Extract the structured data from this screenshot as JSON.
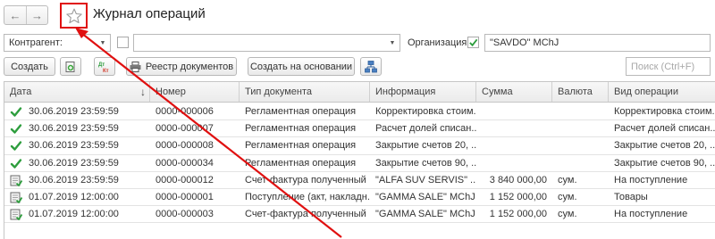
{
  "window": {
    "title": "Журнал операций",
    "back_icon": "arrow-left-icon",
    "forward_icon": "arrow-right-icon",
    "favorite_icon": "star-icon"
  },
  "filters": {
    "counterparty_label": "Контрагент:",
    "counterparty_value": "",
    "counterparty_checked": false,
    "organization_label": "Организация:",
    "organization_checked": true,
    "organization_value": "\"SAVDO\" MChJ"
  },
  "toolbar": {
    "create_label": "Создать",
    "registry_label": "Реестр документов",
    "create_based_label": "Создать на основании",
    "search_placeholder": "Поиск (Ctrl+F)",
    "icons": [
      "add-copy-icon",
      "dt-kt-icon",
      "printer-icon",
      "structure-icon"
    ]
  },
  "table": {
    "columns": [
      "Дата",
      "Номер",
      "Тип документа",
      "Информация",
      "Сумма",
      "Валюта",
      "Вид операции"
    ],
    "sort_column": "Дата",
    "rows": [
      {
        "status": "posted",
        "date": "30.06.2019 23:59:59",
        "number": "0000-000006",
        "type": "Регламентная операция",
        "info": "Корректировка стоим...",
        "sum": "",
        "currency": "",
        "operation": "Корректировка стоим..."
      },
      {
        "status": "posted",
        "date": "30.06.2019 23:59:59",
        "number": "0000-000007",
        "type": "Регламентная операция",
        "info": "Расчет долей списан...",
        "sum": "",
        "currency": "",
        "operation": "Расчет долей списан..."
      },
      {
        "status": "posted",
        "date": "30.06.2019 23:59:59",
        "number": "0000-000008",
        "type": "Регламентная операция",
        "info": "Закрытие счетов 20, ...",
        "sum": "",
        "currency": "",
        "operation": "Закрытие счетов 20, ..."
      },
      {
        "status": "posted",
        "date": "30.06.2019 23:59:59",
        "number": "0000-000034",
        "type": "Регламентная операция",
        "info": "Закрытие счетов 90, ...",
        "sum": "",
        "currency": "",
        "operation": "Закрытие счетов 90, ..."
      },
      {
        "status": "document",
        "date": "30.06.2019 23:59:59",
        "number": "0000-000012",
        "type": "Счет-фактура полученный",
        "info": "\"ALFA SUV SERVIS\" ...",
        "sum": "3 840 000,00",
        "currency": "сум.",
        "operation": "На поступление"
      },
      {
        "status": "document",
        "date": "01.07.2019 12:00:00",
        "number": "0000-000001",
        "type": "Поступление (акт, накладн...",
        "info": "\"GAMMA SALE\" MChJ",
        "sum": "1 152 000,00",
        "currency": "сум.",
        "operation": "Товары"
      },
      {
        "status": "document",
        "date": "01.07.2019 12:00:00",
        "number": "0000-000003",
        "type": "Счет-фактура полученный",
        "info": "\"GAMMA SALE\" MChJ",
        "sum": "1 152 000,00",
        "currency": "сум.",
        "operation": "На поступление"
      }
    ]
  },
  "colors": {
    "highlight": "#e01010",
    "check": "#2e9e3e",
    "header_bg": "#eeeeee"
  }
}
